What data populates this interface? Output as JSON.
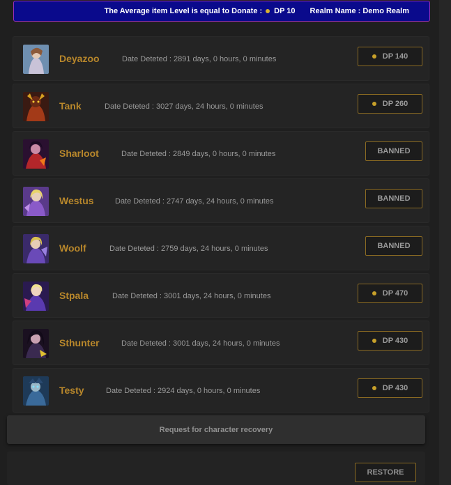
{
  "banner": {
    "text": "The Average item Level is equal to Donate :",
    "dp": "DP 10",
    "realm": "Realm Name : Demo Realm",
    "accent": "#9b2fb5",
    "coin_color": "#d9b232"
  },
  "characters": [
    {
      "name": "Deyazoo",
      "date": "Date Deteted : 2891 days, 0 hours, 0 minutes",
      "status": "DP 140",
      "kind": "dp"
    },
    {
      "name": "Tank",
      "date": "Date Deteted : 3027 days, 24 hours, 0 minutes",
      "status": "DP 260",
      "kind": "dp"
    },
    {
      "name": "Sharloot",
      "date": "Date Deteted : 2849 days, 0 hours, 0 minutes",
      "status": "BANNED",
      "kind": "banned"
    },
    {
      "name": "Westus",
      "date": "Date Deteted : 2747 days, 24 hours, 0 minutes",
      "status": "BANNED",
      "kind": "banned"
    },
    {
      "name": "Woolf",
      "date": "Date Deteted : 2759 days, 24 hours, 0 minutes",
      "status": "BANNED",
      "kind": "banned"
    },
    {
      "name": "Stpala",
      "date": "Date Deteted : 3001 days, 24 hours, 0 minutes",
      "status": "DP 470",
      "kind": "dp"
    },
    {
      "name": "Sthunter",
      "date": "Date Deteted : 3001 days, 24 hours, 0 minutes",
      "status": "DP 430",
      "kind": "dp"
    },
    {
      "name": "Testy",
      "date": "Date Deteted : 2924 days, 0 hours, 0 minutes",
      "status": "DP 430",
      "kind": "dp"
    }
  ],
  "request": {
    "label": "Request for character recovery"
  },
  "restore": {
    "label": "RESTORE"
  }
}
